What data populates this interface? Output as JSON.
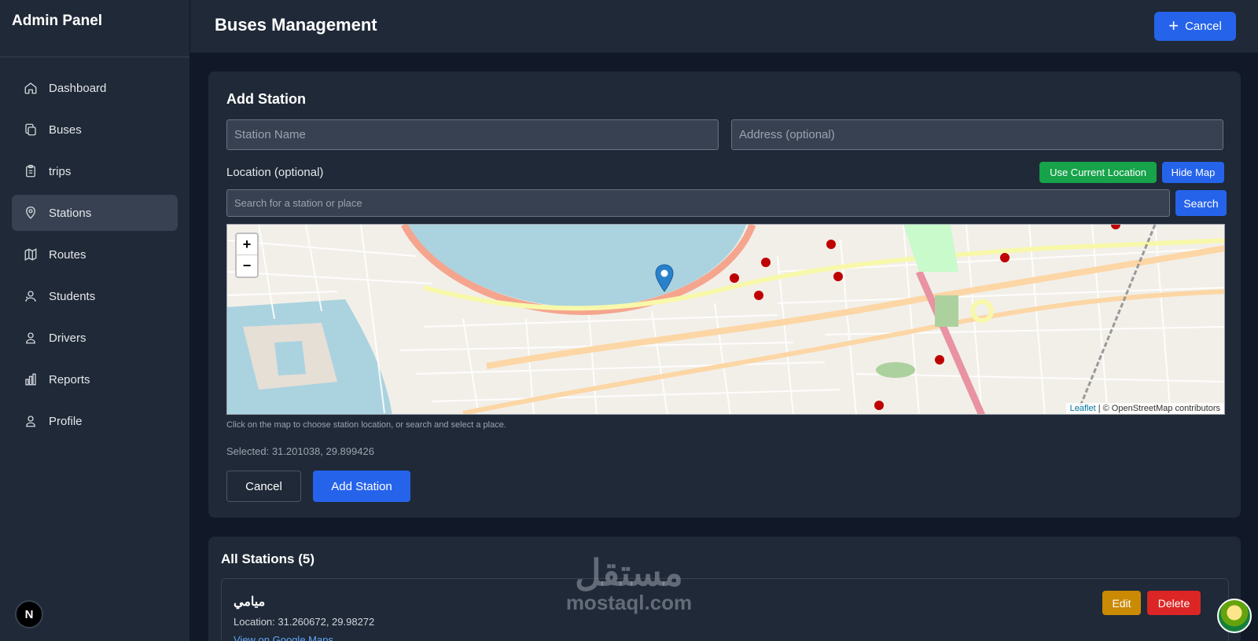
{
  "sidebar": {
    "title": "Admin Panel",
    "items": [
      {
        "label": "Dashboard",
        "icon": "home-icon",
        "active": false
      },
      {
        "label": "Buses",
        "icon": "copy-icon",
        "active": false
      },
      {
        "label": "trips",
        "icon": "clipboard-icon",
        "active": false
      },
      {
        "label": "Stations",
        "icon": "map-pin-icon",
        "active": true
      },
      {
        "label": "Routes",
        "icon": "map-icon",
        "active": false
      },
      {
        "label": "Students",
        "icon": "users-icon",
        "active": false
      },
      {
        "label": "Drivers",
        "icon": "user-icon",
        "active": false
      },
      {
        "label": "Reports",
        "icon": "bar-chart-icon",
        "active": false
      },
      {
        "label": "Profile",
        "icon": "user-icon",
        "active": false
      }
    ],
    "badge": "N"
  },
  "header": {
    "title": "Buses Management",
    "button_label": "Cancel"
  },
  "add_station": {
    "title": "Add Station",
    "name_placeholder": "Station Name",
    "address_placeholder": "Address (optional)",
    "location_label": "Location (optional)",
    "use_location_label": "Use Current Location",
    "hide_map_label": "Hide Map",
    "search_placeholder": "Search for a station or place",
    "search_label": "Search",
    "map": {
      "zoom_in": "+",
      "zoom_out": "−",
      "attribution_link": "Leaflet",
      "attribution_text": "| © OpenStreetMap contributors"
    },
    "hint": "Click on the map to choose station location, or search and select a place.",
    "selected": "Selected: 31.201038, 29.899426",
    "cancel_label": "Cancel",
    "submit_label": "Add Station"
  },
  "stations": {
    "title": "All Stations (5)",
    "items": [
      {
        "name": "ميامي",
        "location": "Location: 31.260672, 29.98272",
        "link": "View on Google Maps",
        "edit": "Edit",
        "delete": "Delete"
      }
    ]
  },
  "watermark": {
    "arabic": "مستقل",
    "latin": "mostaql.com"
  },
  "colors": {
    "primary": "#2563eb",
    "success": "#16a34a",
    "warning": "#ca8a04",
    "danger": "#dc2626",
    "sidebar": "#1f2937",
    "background": "#111827"
  }
}
